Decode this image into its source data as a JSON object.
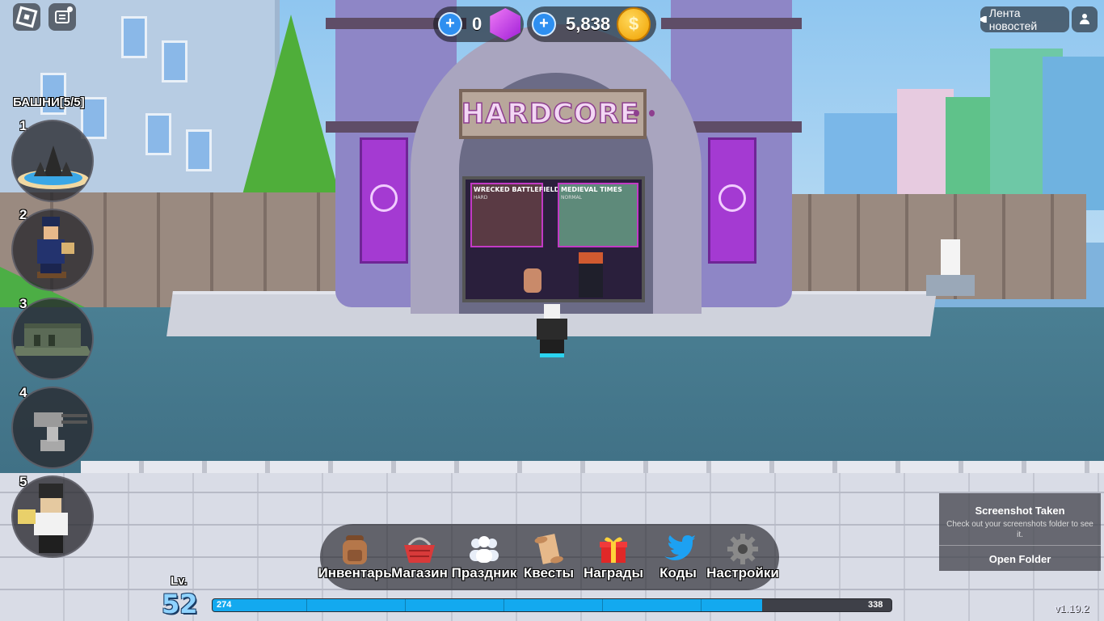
{
  "hud": {
    "gems": "0",
    "coins": "5,838",
    "coin_symbol": "$",
    "news_label": "Лента новостей"
  },
  "scene": {
    "sign_text": "HARDCORE",
    "poster_left_title": "WRECKED BATTLEFIELD",
    "poster_left_sub": "HARD",
    "poster_right_title": "MEDIEVAL TIMES",
    "poster_right_sub": "NORMAL"
  },
  "towers": {
    "title": "БАШНИ[5/5]",
    "slots": [
      {
        "num": "1",
        "icon": "crystal-tower-icon"
      },
      {
        "num": "2",
        "icon": "soldier-tower-icon"
      },
      {
        "num": "3",
        "icon": "bunker-tower-icon"
      },
      {
        "num": "4",
        "icon": "turret-tower-icon"
      },
      {
        "num": "5",
        "icon": "commander-tower-icon"
      }
    ]
  },
  "menu": {
    "items": [
      {
        "label": "Инвентарь",
        "icon": "backpack-icon"
      },
      {
        "label": "Магазин",
        "icon": "basket-icon"
      },
      {
        "label": "Праздник",
        "icon": "people-icon"
      },
      {
        "label": "Квесты",
        "icon": "scroll-icon"
      },
      {
        "label": "Награды",
        "icon": "gift-icon"
      },
      {
        "label": "Коды",
        "icon": "twitter-icon"
      },
      {
        "label": "Настройки",
        "icon": "gear-icon"
      }
    ]
  },
  "level": {
    "label": "Lv.",
    "value": "52",
    "xp_current": "274",
    "xp_max": "338",
    "xp_fraction": 0.81
  },
  "version": "v1.19.2",
  "toast": {
    "title": "Screenshot Taken",
    "message": "Check out your screenshots folder to see it.",
    "button": "Open Folder"
  },
  "colors": {
    "accent": "#13a9ef",
    "level_text": "#8fd3ff",
    "gem": "#c23ae0",
    "coin": "#f5b400"
  }
}
